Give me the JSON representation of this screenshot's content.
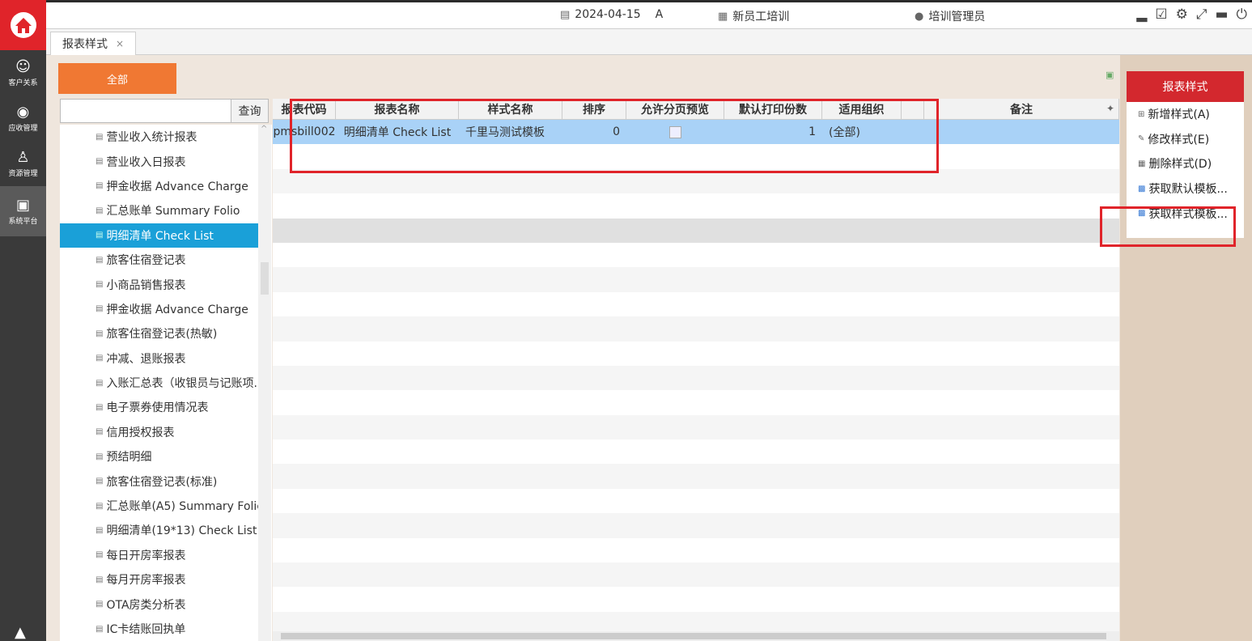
{
  "rail": {
    "items": [
      {
        "label": "客户关系",
        "icon": "people-icon"
      },
      {
        "label": "应收管理",
        "icon": "coins-icon"
      },
      {
        "label": "资源管理",
        "icon": "walker-icon"
      },
      {
        "label": "系统平台",
        "icon": "monitor-gear-icon"
      }
    ]
  },
  "topbar": {
    "date": "2024-04-15",
    "shift": "A",
    "hotel": "新员工培训",
    "user": "培训管理员"
  },
  "tabs": [
    {
      "label": "报表样式",
      "close": "×"
    }
  ],
  "left": {
    "all_button": "全部",
    "search_placeholder": "",
    "search_button": "查询",
    "tree": [
      "营业收入统计报表",
      "营业收入日报表",
      "押金收据 Advance Charge",
      "汇总账单 Summary Folio",
      "明细清单  Check List",
      "旅客住宿登记表",
      "小商品销售报表",
      "押金收据 Advance Charge",
      "旅客住宿登记表(热敏)",
      "冲减、退账报表",
      "入账汇总表（收银员与记账项.",
      "电子票券使用情况表",
      "信用授权报表",
      "预结明细",
      "旅客住宿登记表(标准)",
      "汇总账单(A5) Summary Folic",
      "明细清单(19*13) Check List",
      "每日开房率报表",
      "每月开房率报表",
      "OTA房类分析表",
      "IC卡结账回执单"
    ],
    "selected_index": 4
  },
  "grid": {
    "columns": [
      "报表代码",
      "报表名称",
      "样式名称",
      "排序",
      "允许分页预览",
      "默认打印份数",
      "适用组织",
      "",
      "备注"
    ],
    "rows": [
      {
        "code": "pmsbill002",
        "name": "明细清单  Check List",
        "style": "千里马测试模板",
        "order": "0",
        "paging": false,
        "copies": "1",
        "org": "(全部)",
        "remark": ""
      }
    ]
  },
  "right": {
    "title": "报表样式",
    "actions": [
      {
        "label": "新增样式(A)",
        "icon": "plus-box-icon"
      },
      {
        "label": "修改样式(E)",
        "icon": "edit-icon"
      },
      {
        "label": "删除样式(D)",
        "icon": "trash-icon"
      },
      {
        "label": "获取默认模板...",
        "icon": "template-icon"
      },
      {
        "label": "获取样式模板...",
        "icon": "template-icon"
      }
    ]
  }
}
